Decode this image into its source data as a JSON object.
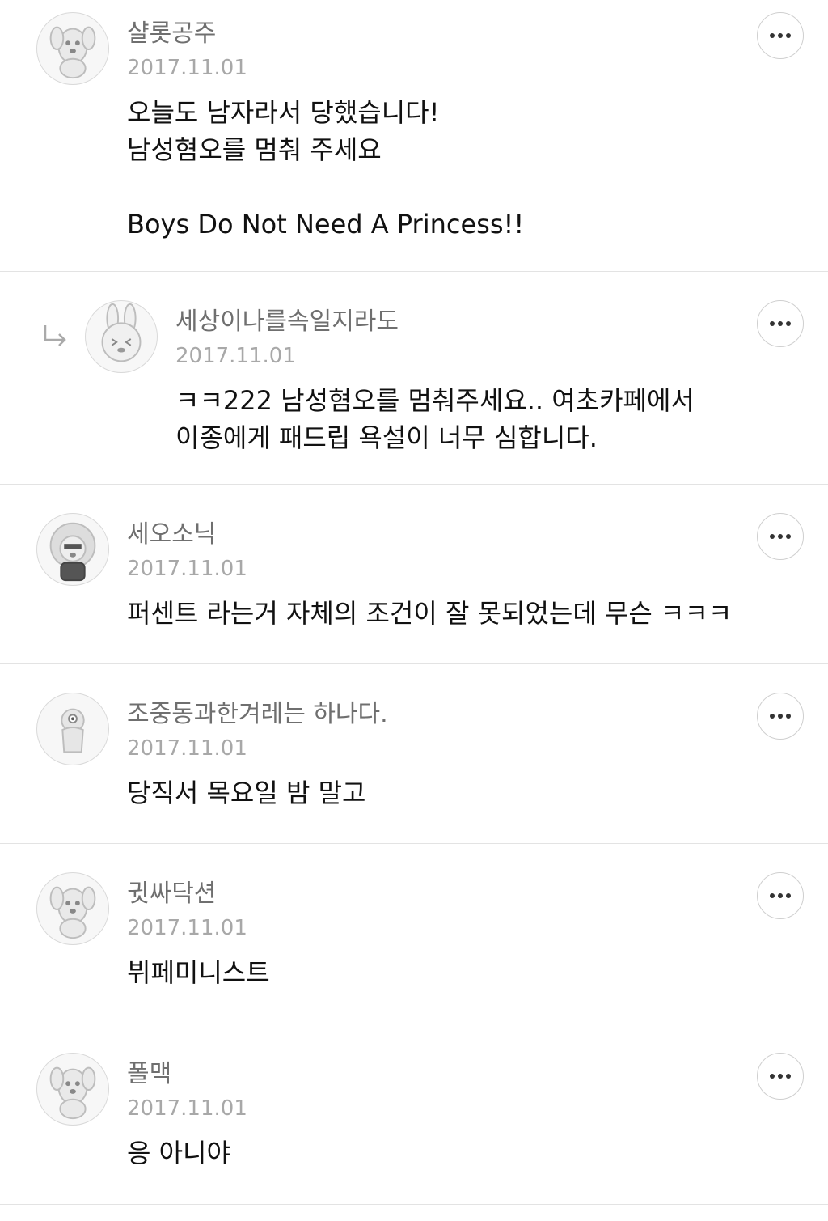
{
  "comments": [
    {
      "author": "샬롯공주",
      "date": "2017.11.01",
      "avatar_icon": "dog-character-avatar-icon",
      "lines": [
        "오늘도 남자라서 당했습니다!",
        "남성혐오를 멈춰 주세요",
        "",
        "Boys Do Not Need A Princess!!"
      ]
    },
    {
      "author": "세상이나를속일지라도",
      "date": "2017.11.01",
      "is_reply": true,
      "avatar_icon": "rabbit-character-avatar-icon",
      "reply_icon": "reply-arrow-icon",
      "lines": [
        "ㅋㅋ222  남성혐오를 멈춰주세요..  여초카페에서",
        "이종에게 패드립 욕설이 너무 심합니다."
      ]
    },
    {
      "author": "세오소닉",
      "date": "2017.11.01",
      "avatar_icon": "curly-hair-character-avatar-icon",
      "lines": [
        "퍼센트 라는거 자체의 조건이 잘 못되었는데 무슨 ㅋㅋㅋ"
      ]
    },
    {
      "author": "조중동과한겨레는 하나다.",
      "date": "2017.11.01",
      "avatar_icon": "cyclops-character-avatar-icon",
      "lines": [
        "당직서 목요일 밤 말고"
      ]
    },
    {
      "author": "귓싸닥션",
      "date": "2017.11.01",
      "avatar_icon": "dog-character-avatar-icon",
      "lines": [
        "뷔페미니스트"
      ]
    },
    {
      "author": "폴맥",
      "date": "2017.11.01",
      "avatar_icon": "dog-character-avatar-icon",
      "lines": [
        "응 아니야"
      ]
    }
  ],
  "more_icon": "more-options-icon"
}
